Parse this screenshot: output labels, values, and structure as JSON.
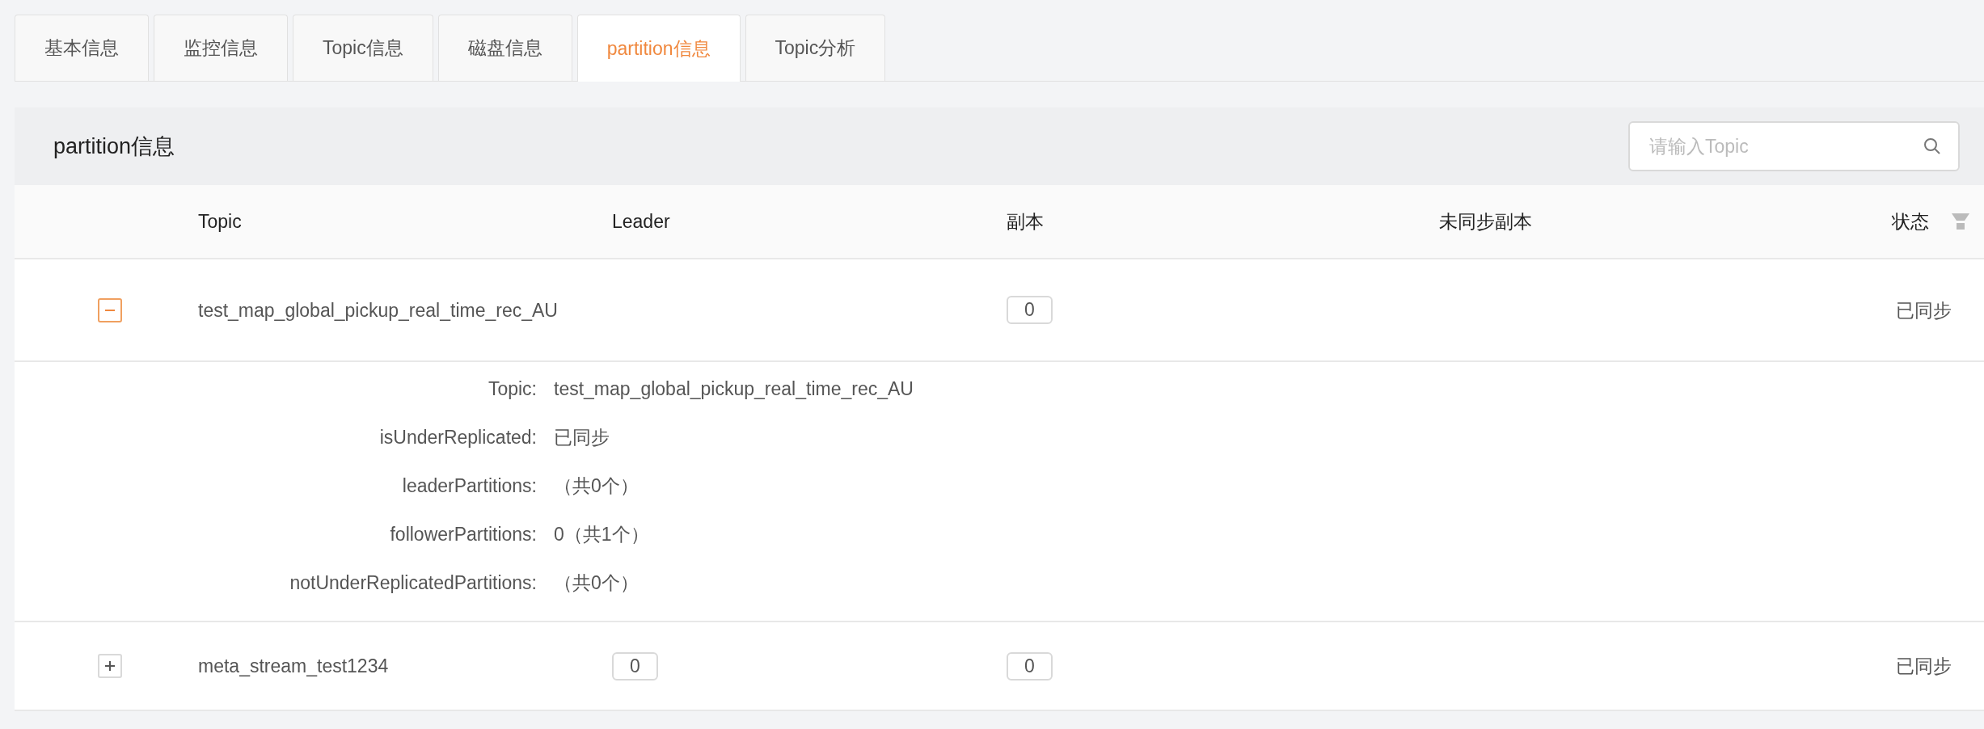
{
  "tabs": [
    {
      "label": "基本信息",
      "selected": false
    },
    {
      "label": "监控信息",
      "selected": false
    },
    {
      "label": "Topic信息",
      "selected": false
    },
    {
      "label": "磁盘信息",
      "selected": false
    },
    {
      "label": "partition信息",
      "selected": true
    },
    {
      "label": "Topic分析",
      "selected": false
    }
  ],
  "panel": {
    "title": "partition信息",
    "search": {
      "placeholder": "请输入Topic"
    }
  },
  "table": {
    "columns": [
      "Topic",
      "Leader",
      "副本",
      "未同步副本",
      "状态"
    ],
    "rows": [
      {
        "expanded": true,
        "topic": "test_map_global_pickup_real_time_rec_AU",
        "leader": "",
        "replicas": "0",
        "unsynced": "",
        "status": "已同步",
        "details": [
          {
            "label": "Topic:",
            "value": "test_map_global_pickup_real_time_rec_AU"
          },
          {
            "label": "isUnderReplicated:",
            "value": "已同步"
          },
          {
            "label": "leaderPartitions:",
            "value": "（共0个）"
          },
          {
            "label": "followerPartitions:",
            "value": "0（共1个）"
          },
          {
            "label": "notUnderReplicatedPartitions:",
            "value": "（共0个）"
          }
        ]
      },
      {
        "expanded": false,
        "topic": "meta_stream_test1234",
        "leader": "0",
        "replicas": "0",
        "unsynced": "",
        "status": "已同步"
      }
    ]
  }
}
